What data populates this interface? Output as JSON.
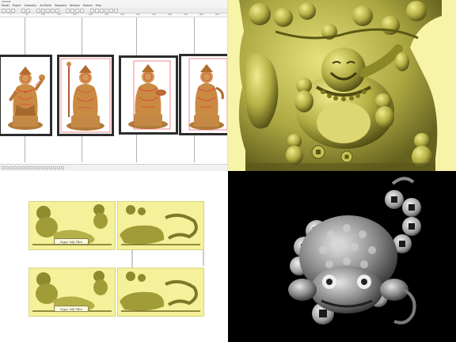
{
  "window_title": "ArtCAM",
  "menu": {
    "items": [
      "Model",
      "Project",
      "Geometry",
      "Art Relief",
      "Toolpaths",
      "Window",
      "Rasters",
      "Help"
    ]
  },
  "ruler_labels": [
    "0",
    "50",
    "100",
    "150",
    "200",
    "250",
    "300",
    "350",
    "400",
    "450",
    "500",
    "550",
    "600",
    "650"
  ],
  "plaques": [
    "Ngọc Mỹ Tâm",
    "Ngọc Mỹ Tâm"
  ],
  "colors": {
    "selection": "#e23b3b",
    "relief_bg": "#f7f4a8",
    "relief_gold": "#a8a23a",
    "gray_bg": "#000000"
  },
  "icons": [
    "new-file-icon",
    "open-icon",
    "save-icon",
    "undo-icon",
    "redo-icon",
    "zoom-icon",
    "select-icon",
    "move-icon"
  ]
}
